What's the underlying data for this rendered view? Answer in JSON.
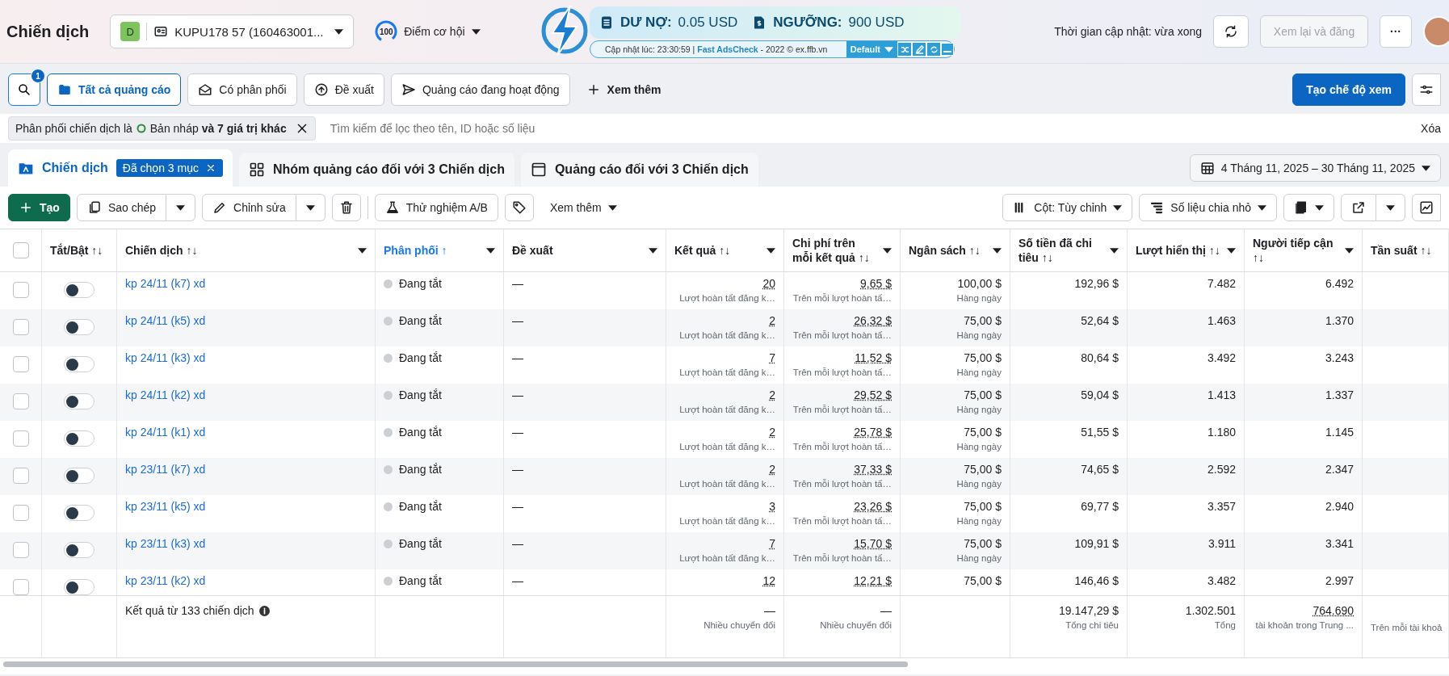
{
  "header": {
    "title": "Chiến dịch",
    "account": {
      "badge": "D",
      "name": "KUPU178 57 (160463001..."
    },
    "score": {
      "value": "100",
      "label": "Điểm cơ hội"
    },
    "updated": "Thời gian cập nhật: vừa xong",
    "review_button": {
      "label": "Xem lại và đăng",
      "disabled": true
    },
    "more_button": "···"
  },
  "extension": {
    "debt_label": "DƯ NỢ:",
    "debt_value": "0.05 USD",
    "threshold_label": "NGƯỠNG:",
    "threshold_value": "900 USD",
    "footer": "Cập nhật lúc: 23:30:59 | **Fast AdsCheck** - 2022 © ex.ffb.vn",
    "preset": "Default"
  },
  "search_badge": "1",
  "view_tabs": [
    {
      "label": "Tất cả quảng cáo",
      "selected": true
    },
    {
      "label": "Có phân phối",
      "selected": false
    },
    {
      "label": "Đề xuất",
      "selected": false
    },
    {
      "label": "Quảng cáo đang hoạt động",
      "selected": false
    }
  ],
  "more_views": "Xem thêm",
  "create_view": "Tạo chế độ xem",
  "filter": {
    "prefix": "Phân phối chiến dịch là",
    "value": "Bản nháp **và 7 giá trị khác**",
    "placeholder": "Tìm kiếm để lọc theo tên, ID hoặc số liệu",
    "clear": "Xóa"
  },
  "level_tabs": [
    {
      "label": "Chiến dịch",
      "selected": true,
      "badge": "Đã chọn 3 mục"
    },
    {
      "label": "Nhóm quảng cáo đối với 3 Chiến dịch",
      "selected": false
    },
    {
      "label": "Quảng cáo đối với 3 Chiến dịch",
      "selected": false
    }
  ],
  "date_range": "4 Tháng 11, 2025 – 30 Tháng 11, 2025",
  "toolbar": {
    "create": "Tạo",
    "duplicate": "Sao chép",
    "edit": "Chỉnh sửa",
    "ab_test": "Thử nghiệm A/B",
    "more": "Xem thêm",
    "columns": "Cột: Tùy chỉnh",
    "breakdown": "Số liệu chia nhỏ"
  },
  "table": {
    "select_all": {
      "checked": false
    },
    "columns": [
      {
        "label": "Tắt/Bật ↑↓",
        "sorted": false,
        "menu": false
      },
      {
        "label": "Chiến dịch ↑↓",
        "sorted": false,
        "menu": true
      },
      {
        "label": "Phân phối ↑",
        "sorted": true,
        "menu": true
      },
      {
        "label": "Đề xuất",
        "sorted": false,
        "menu": true
      },
      {
        "label": "Kết quả ↑↓",
        "sorted": false,
        "menu": true
      },
      {
        "label": "Chi phí trên mỗi kết quả ↑↓",
        "sorted": false,
        "menu": true
      },
      {
        "label": "Ngân sách ↑↓",
        "sorted": false,
        "menu": true
      },
      {
        "label": "Số tiền đã chi tiêu ↑↓",
        "sorted": false,
        "menu": true
      },
      {
        "label": "Lượt hiển thị ↑↓",
        "sorted": false,
        "menu": true
      },
      {
        "label": "Người tiếp cận ↑↓",
        "sorted": false,
        "menu": true
      },
      {
        "label": "Tần suất ↑↓",
        "sorted": false,
        "menu": false
      }
    ],
    "rows": [
      {
        "checked": false,
        "on": false,
        "name": "kp 24/11 (k7) xd",
        "delivery": "Đang tắt",
        "suggestion": "—",
        "result": "20",
        "result_label": "Lượt hoàn tất đăng k…",
        "cost": "9,65 $",
        "cost_label": "Trên mỗi lượt hoàn tấ…",
        "budget": "100,00 $",
        "budget_label": "Hàng ngày",
        "spent": "192,96 $",
        "impressions": "7.482",
        "reach": "6.492"
      },
      {
        "checked": false,
        "on": false,
        "name": "kp 24/11 (k5) xd",
        "delivery": "Đang tắt",
        "suggestion": "—",
        "result": "2",
        "result_label": "Lượt hoàn tất đăng k…",
        "cost": "26,32 $",
        "cost_label": "Trên mỗi lượt hoàn tấ…",
        "budget": "75,00 $",
        "budget_label": "Hàng ngày",
        "spent": "52,64 $",
        "impressions": "1.463",
        "reach": "1.370"
      },
      {
        "checked": false,
        "on": false,
        "name": "kp 24/11 (k3) xd",
        "delivery": "Đang tắt",
        "suggestion": "—",
        "result": "7",
        "result_label": "Lượt hoàn tất đăng k…",
        "cost": "11,52 $",
        "cost_label": "Trên mỗi lượt hoàn tấ…",
        "budget": "75,00 $",
        "budget_label": "Hàng ngày",
        "spent": "80,64 $",
        "impressions": "3.492",
        "reach": "3.243"
      },
      {
        "checked": false,
        "on": false,
        "name": "kp 24/11 (k2) xd",
        "delivery": "Đang tắt",
        "suggestion": "—",
        "result": "2",
        "result_label": "Lượt hoàn tất đăng k…",
        "cost": "29,52 $",
        "cost_label": "Trên mỗi lượt hoàn tấ…",
        "budget": "75,00 $",
        "budget_label": "Hàng ngày",
        "spent": "59,04 $",
        "impressions": "1.413",
        "reach": "1.337"
      },
      {
        "checked": false,
        "on": false,
        "name": "kp 24/11 (k1) xd",
        "delivery": "Đang tắt",
        "suggestion": "—",
        "result": "2",
        "result_label": "Lượt hoàn tất đăng k…",
        "cost": "25,78 $",
        "cost_label": "Trên mỗi lượt hoàn tấ…",
        "budget": "75,00 $",
        "budget_label": "Hàng ngày",
        "spent": "51,55 $",
        "impressions": "1.180",
        "reach": "1.145"
      },
      {
        "checked": false,
        "on": false,
        "name": "kp 23/11 (k7) xd",
        "delivery": "Đang tắt",
        "suggestion": "—",
        "result": "2",
        "result_label": "Lượt hoàn tất đăng k…",
        "cost": "37,33 $",
        "cost_label": "Trên mỗi lượt hoàn tấ…",
        "budget": "75,00 $",
        "budget_label": "Hàng ngày",
        "spent": "74,65 $",
        "impressions": "2.592",
        "reach": "2.347"
      },
      {
        "checked": false,
        "on": false,
        "name": "kp 23/11 (k5) xd",
        "delivery": "Đang tắt",
        "suggestion": "—",
        "result": "3",
        "result_label": "Lượt hoàn tất đăng k…",
        "cost": "23,26 $",
        "cost_label": "Trên mỗi lượt hoàn tấ…",
        "budget": "75,00 $",
        "budget_label": "Hàng ngày",
        "spent": "69,77 $",
        "impressions": "3.357",
        "reach": "2.940"
      },
      {
        "checked": false,
        "on": false,
        "name": "kp 23/11 (k3) xd",
        "delivery": "Đang tắt",
        "suggestion": "—",
        "result": "7",
        "result_label": "Lượt hoàn tất đăng k…",
        "cost": "15,70 $",
        "cost_label": "Trên mỗi lượt hoàn tấ…",
        "budget": "75,00 $",
        "budget_label": "Hàng ngày",
        "spent": "109,91 $",
        "impressions": "3.911",
        "reach": "3.341"
      },
      {
        "checked": false,
        "on": false,
        "name": "kp 23/11 (k2) xd",
        "delivery": "Đang tắt",
        "suggestion": "—",
        "result": "12",
        "cost": "12,21 $",
        "budget": "75,00 $",
        "spent": "146,46 $",
        "impressions": "3.482",
        "reach": "2.997"
      }
    ],
    "totals": {
      "label": "Kết quả từ 133 chiến dịch",
      "result": "—",
      "result_label": "Nhiều chuyển đổi",
      "cost": "—",
      "cost_label": "Nhiều chuyển đổi",
      "spent": "19.147,29 $",
      "spent_label": "Tổng chi tiêu",
      "impressions": "1.302.501",
      "impressions_label": "Tổng",
      "reach": "764.690",
      "reach_label": "tài khoản trong Trung ...",
      "frequency_label": "Trên mỗi tài khoả"
    }
  }
}
